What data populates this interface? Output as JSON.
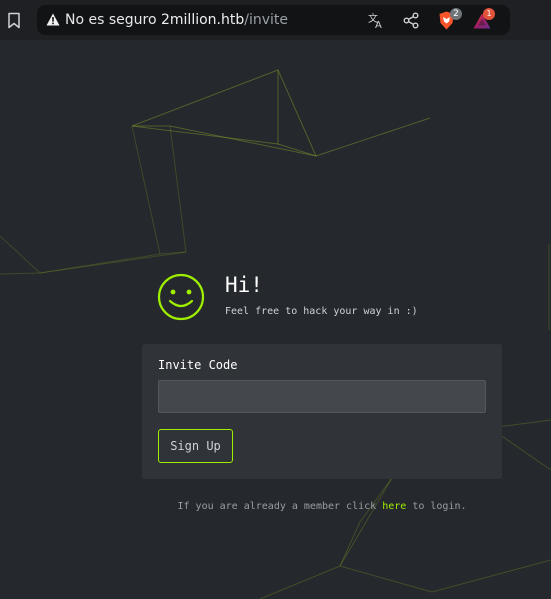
{
  "browser": {
    "security_label": "No es seguro",
    "url_host": "2million.htb",
    "url_path": "/invite",
    "brave_shields_count": "2",
    "rewards_count": "1",
    "icons": [
      "bookmark-icon",
      "warning-icon",
      "translate-icon",
      "share-icon",
      "brave-shields-icon",
      "brave-rewards-icon"
    ]
  },
  "page": {
    "greeting": "Hi!",
    "subtitle": "Feel free to hack your way in :)",
    "form": {
      "label": "Invite Code",
      "input_value": "",
      "input_placeholder": "",
      "submit_label": "Sign Up"
    },
    "login": {
      "prefix": "If you are already a member click",
      "link": "here",
      "suffix": "to login."
    }
  },
  "colors": {
    "page_background": "#25282c",
    "card_background": "#303337",
    "accent": "#9fef00",
    "url_bar": "#121315"
  }
}
